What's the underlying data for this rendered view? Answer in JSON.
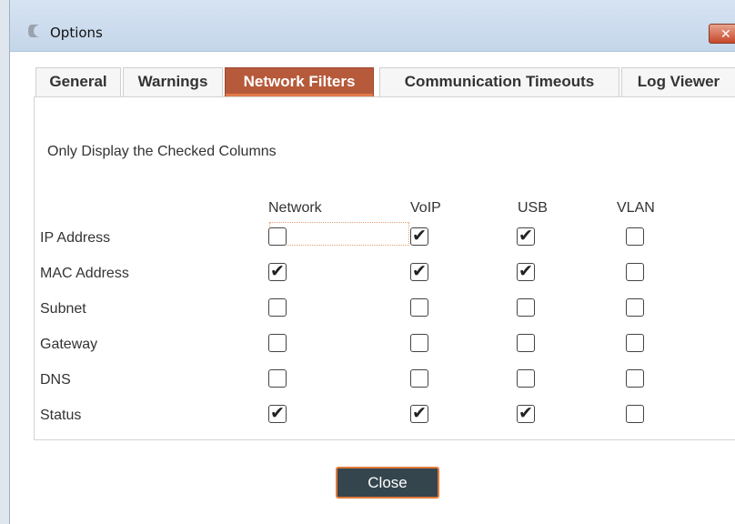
{
  "window": {
    "title": "Options",
    "close_glyph": "✕"
  },
  "tabs": [
    {
      "label": "General",
      "active": false
    },
    {
      "label": "Warnings",
      "active": false
    },
    {
      "label": "Network Filters",
      "active": true
    },
    {
      "label": "Communication Timeouts",
      "active": false
    },
    {
      "label": "Log Viewer",
      "active": false
    }
  ],
  "panel": {
    "instruction": "Only Display the Checked Columns",
    "columns": [
      "Network",
      "VoIP",
      "USB",
      "VLAN"
    ],
    "rows": [
      {
        "label": "IP Address",
        "checks": [
          false,
          true,
          true,
          false
        ]
      },
      {
        "label": "MAC Address",
        "checks": [
          true,
          true,
          true,
          false
        ]
      },
      {
        "label": "Subnet",
        "checks": [
          false,
          false,
          false,
          false
        ]
      },
      {
        "label": "Gateway",
        "checks": [
          false,
          false,
          false,
          false
        ]
      },
      {
        "label": "DNS",
        "checks": [
          false,
          false,
          false,
          false
        ]
      },
      {
        "label": "Status",
        "checks": [
          true,
          true,
          true,
          false
        ]
      }
    ]
  },
  "footer": {
    "close_label": "Close"
  },
  "colors": {
    "accent": "#b65a3b",
    "button_bg": "#34454e",
    "button_border": "#e07a3a"
  }
}
